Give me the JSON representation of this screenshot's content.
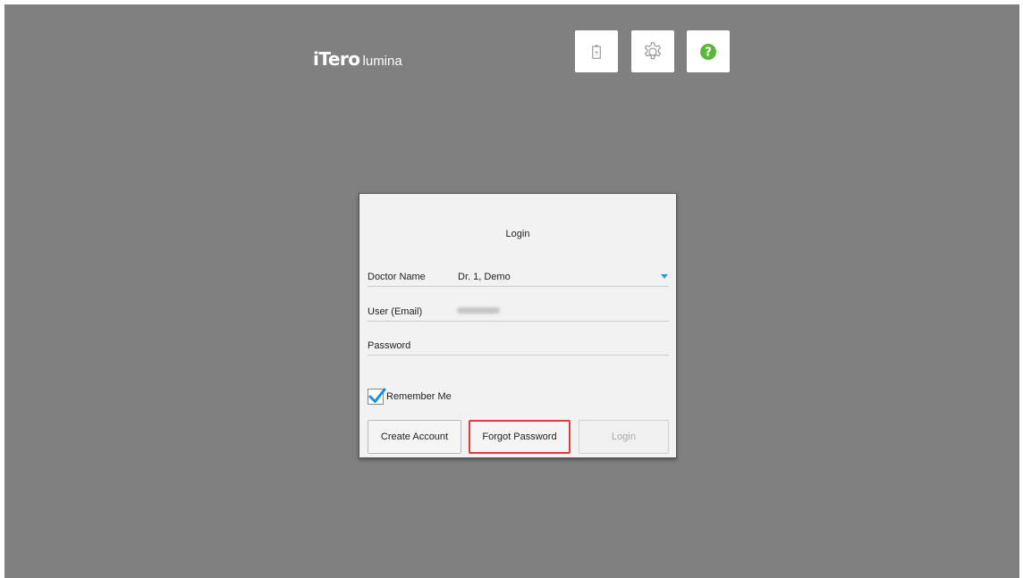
{
  "header": {
    "logo_brand": "iTero",
    "logo_sub": "lumina",
    "icons": {
      "battery": "battery-icon",
      "settings": "gear-icon",
      "help": "help-icon"
    },
    "help_color": "#5cb83a"
  },
  "login": {
    "title": "Login",
    "doctor_label": "Doctor Name",
    "doctor_value": "Dr. 1, Demo",
    "user_label": "User (Email)",
    "password_label": "Password",
    "remember_label": "Remember Me",
    "remember_checked": true,
    "buttons": {
      "create": "Create Account",
      "forgot": "Forgot Password",
      "login": "Login"
    },
    "accent_color": "#2a9be0",
    "highlight_color": "#e03c3c"
  }
}
